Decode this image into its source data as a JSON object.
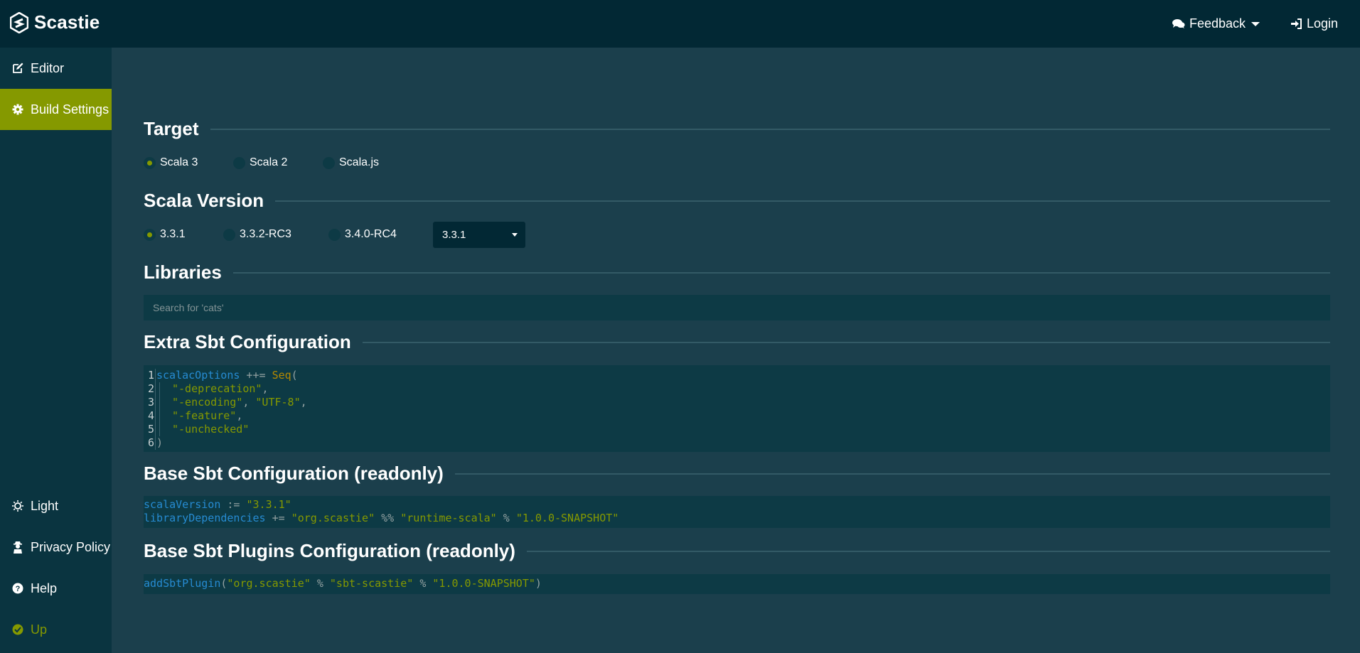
{
  "header": {
    "brand": "Scastie",
    "feedback_label": "Feedback",
    "login_label": "Login"
  },
  "sidebar": {
    "items": [
      {
        "label": "Editor",
        "icon": "edit-icon",
        "active": false
      },
      {
        "label": "Build Settings",
        "icon": "gear-icon",
        "active": true
      }
    ],
    "bottom_items": [
      {
        "label": "Light",
        "icon": "sun-icon"
      },
      {
        "label": "Privacy Policy",
        "icon": "user-secret-icon"
      },
      {
        "label": "Help",
        "icon": "question-circle-icon"
      },
      {
        "label": "Up",
        "icon": "check-circle-icon"
      }
    ]
  },
  "sections": {
    "target": "Target",
    "scala_version": "Scala Version",
    "libraries": "Libraries",
    "extra_sbt": "Extra Sbt Configuration",
    "base_sbt": "Base Sbt Configuration (readonly)",
    "base_plugins": "Base Sbt Plugins Configuration (readonly)"
  },
  "target": {
    "options": [
      "Scala 3",
      "Scala 2",
      "Scala.js"
    ],
    "selected": "Scala 3"
  },
  "scala_version": {
    "options": [
      "3.3.1",
      "3.3.2-RC3",
      "3.4.0-RC4"
    ],
    "selected": "3.3.1",
    "dropdown_value": "3.3.1"
  },
  "libraries": {
    "search_placeholder": "Search for 'cats'"
  },
  "extra_sbt": {
    "line_numbers": [
      "1",
      "2",
      "3",
      "4",
      "5",
      "6"
    ],
    "lines": [
      "scalacOptions ++= Seq(",
      "\"-deprecation\",",
      "\"-encoding\", \"UTF-8\",",
      "\"-feature\",",
      "\"-unchecked\"",
      ")"
    ]
  },
  "base_sbt": {
    "lines": [
      "scalaVersion := \"3.3.1\"",
      "libraryDependencies += \"org.scastie\" %% \"runtime-scala\" % \"1.0.0-SNAPSHOT\""
    ]
  },
  "base_plugins": {
    "lines": [
      "addSbtPlugin(\"org.scastie\" % \"sbt-scastie\" % \"1.0.0-SNAPSHOT\")"
    ]
  },
  "colors": {
    "accent": "#859900",
    "topbar": "#022834",
    "sidebar": "#0a3440",
    "content": "#1b3f4c",
    "code_bg": "#0d3a45"
  }
}
